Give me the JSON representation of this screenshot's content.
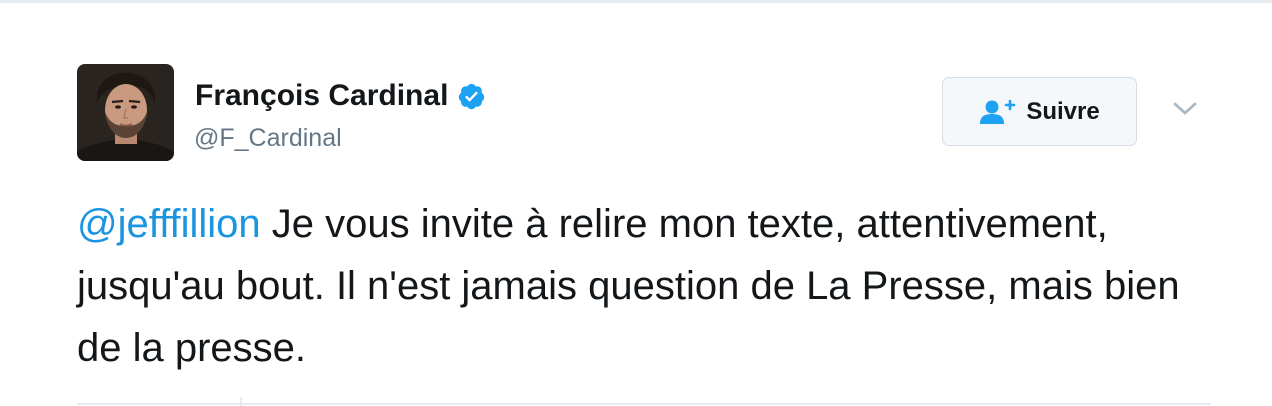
{
  "tweet": {
    "author": {
      "name": "François Cardinal",
      "handle": "@F_Cardinal",
      "verified": true,
      "avatar_icon": "profile-photo"
    },
    "follow_button": {
      "label": "Suivre",
      "icon": "add-user-icon"
    },
    "more_icon": "chevron-down-icon",
    "text": {
      "mention": "@jefffillion",
      "body": " Je vous invite à relire mon texte, attentivement, jusqu'au bout. Il n'est jamais question de La Presse, mais bien de la presse."
    }
  },
  "colors": {
    "link": "#1b95e0",
    "verified_badge": "#1da1f2",
    "text": "#14171a",
    "secondary_text": "#657786",
    "border": "#e6ecf0",
    "button_bg": "#f5f8fa"
  }
}
